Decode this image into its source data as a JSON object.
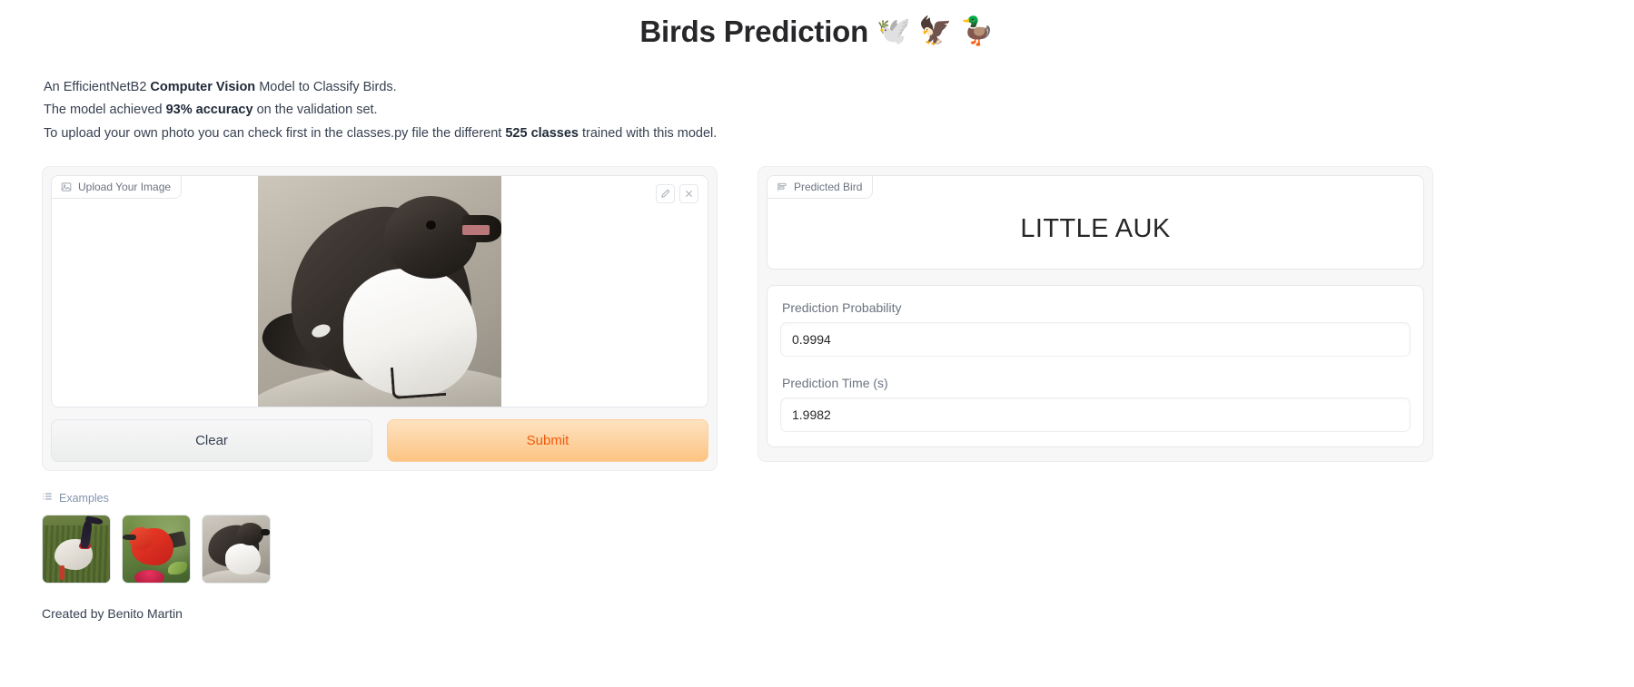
{
  "header": {
    "title": "Birds Prediction",
    "emojis": [
      "🕊️",
      "🦅",
      "🦆"
    ],
    "emoji_names": [
      "dove-emoji",
      "eagle-emoji",
      "duck-emoji"
    ]
  },
  "description": {
    "line1_a": "An EfficientNetB2 ",
    "line1_b": "Computer Vision",
    "line1_c": " Model to Classify Birds.",
    "line2_a": "The model achieved ",
    "line2_b": "93% accuracy",
    "line2_c": " on the validation set.",
    "line3_a": "To upload your own photo you can check first in the classes.py file the different ",
    "line3_b": "525 classes",
    "line3_c": " trained with this model."
  },
  "input_panel": {
    "block_label": "Upload Your Image",
    "edit_tool_title": "Edit",
    "clear_tool_title": "Remove Image",
    "image_alt": "Little Auk perched on a rock",
    "clear_label": "Clear",
    "submit_label": "Submit"
  },
  "output_panel": {
    "predicted_label": "Predicted Bird",
    "predicted_value": "LITTLE AUK",
    "probability_label": "Prediction Probability",
    "probability_value": "0.9994",
    "time_label": "Prediction Time (s)",
    "time_value": "1.9982"
  },
  "examples": {
    "label": "Examples",
    "items": [
      {
        "alt": "Jabiru stork standing on grass"
      },
      {
        "alt": "Red honeycreeper on a flowering branch"
      },
      {
        "alt": "Little auk on a rock"
      }
    ]
  },
  "footer": {
    "credit": "Created by Benito Martin"
  },
  "colors": {
    "submit_text": "#f05a0c",
    "submit_bg_start": "#fee2c0",
    "submit_bg_end": "#fcc483",
    "panel_bg": "#f7f7f8",
    "card_border": "#e5e7eb",
    "text_primary": "#27272a",
    "label_muted": "#6b7280",
    "examples_label": "#8494ad"
  }
}
